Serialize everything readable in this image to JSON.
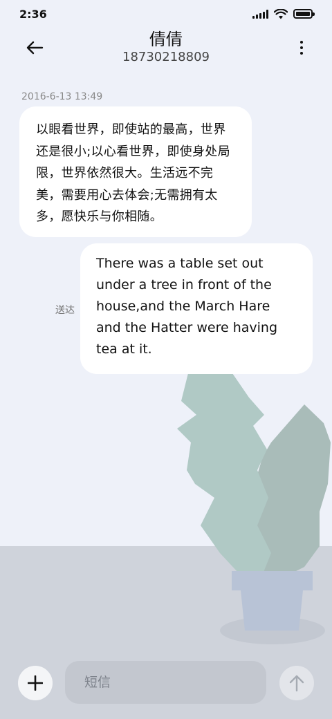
{
  "status_bar": {
    "time": "2:36",
    "icons": [
      "signal-icon",
      "wifi-icon",
      "battery-icon"
    ]
  },
  "header": {
    "back_icon": "arrow-left-icon",
    "contact_name": "倩倩",
    "phone_number": "18730218809",
    "more_icon": "more-vertical-icon"
  },
  "conversation": {
    "timestamp": "2016-6-13 13:49",
    "messages": [
      {
        "direction": "incoming",
        "text": "以眼看世界，即使站的最高，世界还是很小;以心看世界，即使身处局限，世界依然很大。生活远不完美，需要用心去体会;无需拥有太多，愿快乐与你相随。"
      },
      {
        "direction": "outgoing",
        "text": "There was a table set out under a tree in front of the house,and the March Hare and the Hatter were having tea at it.",
        "status": "送达"
      }
    ]
  },
  "composer": {
    "add_icon": "plus-icon",
    "placeholder": "短信",
    "value": "",
    "send_icon": "arrow-up-icon"
  },
  "colors": {
    "background": "#eef1f9",
    "floor": "#cfd3db",
    "bubble": "#ffffff",
    "leaf_front": "#b0c9c5",
    "leaf_back": "#a9bcb9",
    "pot": "#b8c3d6"
  }
}
